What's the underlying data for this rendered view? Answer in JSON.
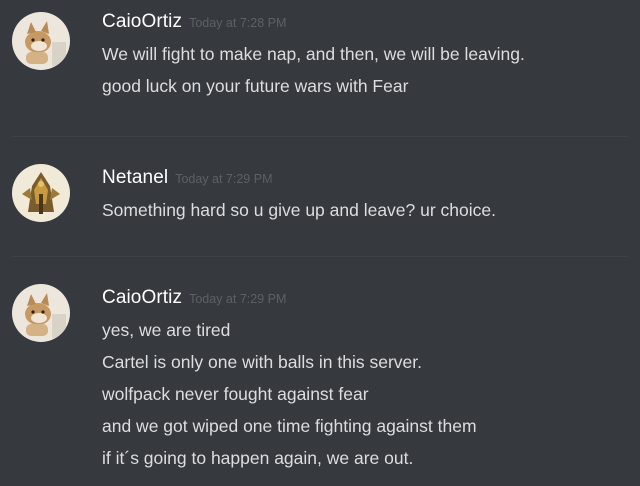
{
  "messages": [
    {
      "username": "CaioOrtiz",
      "timestamp": "Today at 7:28 PM",
      "avatar_icon": "cat-avatar-icon",
      "lines": [
        "We will fight to make nap, and then,  we will be leaving.",
        "good luck on your future wars with Fear"
      ]
    },
    {
      "username": "Netanel",
      "timestamp": "Today at 7:29 PM",
      "avatar_icon": "knight-avatar-icon",
      "lines": [
        "Something hard so u give up and leave? ur choice."
      ]
    },
    {
      "username": "CaioOrtiz",
      "timestamp": "Today at 7:29 PM",
      "avatar_icon": "cat-avatar-icon",
      "lines": [
        "yes, we are tired",
        "Cartel is only one with balls in this server.",
        "wolfpack never fought against fear",
        "and we got wiped one time fighting against them",
        "if it´s going to happen again, we are out."
      ]
    }
  ],
  "colors": {
    "background": "#36393e",
    "username": "#ffffff",
    "timestamp": "#5d6066",
    "message_text": "#dcddde",
    "divider": "#3f4248"
  }
}
